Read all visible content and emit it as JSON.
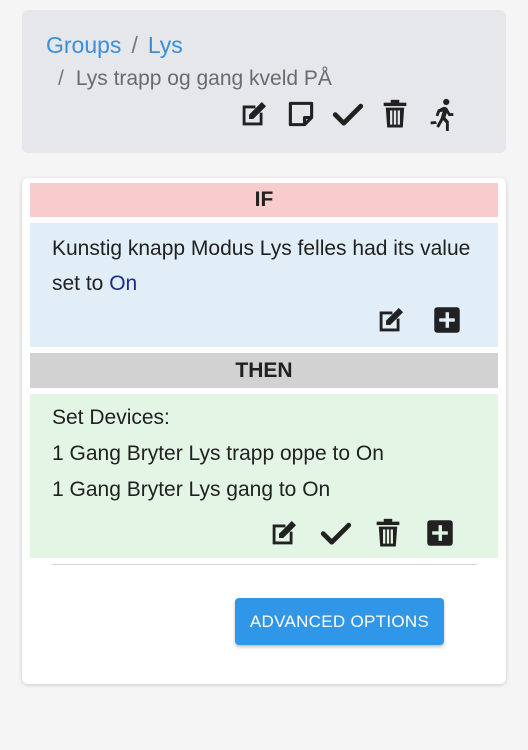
{
  "breadcrumb": {
    "items": [
      "Groups",
      "Lys"
    ],
    "separator": "/",
    "current": "Lys trapp og gang kveld PÅ"
  },
  "header_icons": [
    "edit-icon",
    "note-icon",
    "check-icon",
    "trash-icon",
    "run-icon"
  ],
  "if_section": {
    "label": "IF",
    "condition_text": "Kunstig knapp Modus Lys felles had its value set to",
    "condition_value": "On",
    "icons": [
      "edit-icon",
      "plus-square-icon"
    ]
  },
  "then_section": {
    "label": "THEN",
    "actions": [
      "Set Devices:",
      "1 Gang Bryter Lys trapp oppe to On",
      "1 Gang Bryter Lys gang to On"
    ],
    "icons": [
      "edit-icon",
      "check-icon",
      "trash-icon",
      "plus-square-icon"
    ]
  },
  "advanced_button": "ADVANCED OPTIONS",
  "colors": {
    "link": "#3a8fd8",
    "if_header": "#f8cccc",
    "if_body": "#e1eef8",
    "then_header": "#d2d2d2",
    "then_body": "#e3f6e5",
    "button": "#2f96e8",
    "value_text": "#1e2a8a"
  }
}
